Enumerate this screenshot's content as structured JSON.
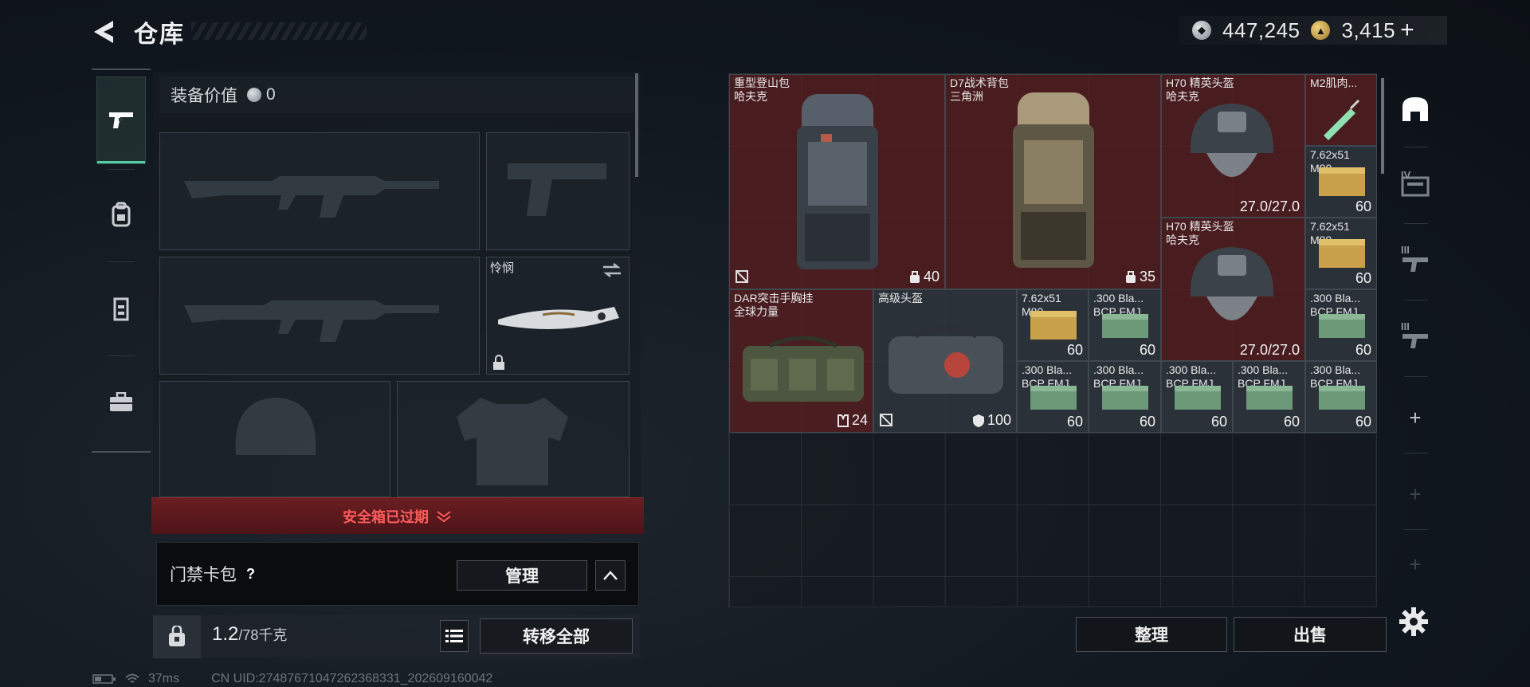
{
  "header": {
    "title": "仓库",
    "currency": [
      {
        "icon": "silver-coin-icon",
        "value": "447,245"
      },
      {
        "icon": "gold-coin-icon",
        "value": "3,415"
      }
    ],
    "add_symbol": "+"
  },
  "nav": [
    {
      "icon": "pistol-icon",
      "active": true
    },
    {
      "icon": "backpack-icon",
      "active": false
    },
    {
      "icon": "chest-rig-icon",
      "active": false
    },
    {
      "icon": "briefcase-icon",
      "active": false
    }
  ],
  "equipment": {
    "value_label": "装备价值",
    "value": "0",
    "melee_label": "怜悯",
    "safe_box_text": "安全箱已过期",
    "keycard_label": "门禁卡包",
    "help_symbol": "?",
    "manage_label": "管理",
    "weight_current": "1.2",
    "weight_max": "/78千克",
    "transfer_label": "转移全部"
  },
  "storage": {
    "items": [
      {
        "name": "重型登山包\n哈夫克",
        "badge": "40",
        "badge_icon": "capacity-icon",
        "corner_icon": "no-insure-icon",
        "bg": "red"
      },
      {
        "name": "D7战术背包\n三角洲",
        "badge": "35",
        "badge_icon": "capacity-icon",
        "corner_icon": "",
        "bg": "red"
      },
      {
        "name": "H70 精英头盔\n哈夫克",
        "count": "27.0/27.0",
        "bg": "red"
      },
      {
        "name": "M2肌肉...",
        "count": "",
        "bg": "red"
      },
      {
        "name": "7.62x51\nM80",
        "count": "60",
        "bg": "dark"
      },
      {
        "name": "H70 精英头盔\n哈夫克",
        "count": "27.0/27.0",
        "bg": "red"
      },
      {
        "name": "7.62x51\nM80",
        "count": "60",
        "bg": "dark"
      },
      {
        "name": "DAR突击手胸挂\n全球力量",
        "badge": "24",
        "badge_icon": "rig-capacity-icon",
        "bg": "red"
      },
      {
        "name": "高级头盔",
        "badge": "100",
        "badge_icon": "shield-icon",
        "corner_icon": "no-insure-icon",
        "bg": "dark"
      },
      {
        "name": "7.62x51\nM80",
        "count": "60",
        "bg": "dark"
      },
      {
        "name": ".300 Bla...\nBCP FMJ",
        "count": "60",
        "bg": "dark"
      },
      {
        "name": ".300 Bla...\nBCP FMJ",
        "count": "60",
        "bg": "dark"
      },
      {
        "name": ".300 Bla...\nBCP FMJ",
        "count": "60",
        "bg": "dark"
      },
      {
        "name": ".300 Bla...\nBCP FMJ",
        "count": "60",
        "bg": "dark"
      },
      {
        "name": ".300 Bla...\nBCP FMJ",
        "count": "60",
        "bg": "dark"
      },
      {
        "name": ".300 Bla...\nBCP FMJ",
        "count": "60",
        "bg": "dark"
      },
      {
        "name": ".300 Bla...\nBCP FMJ",
        "count": "60",
        "bg": "dark"
      }
    ],
    "sort_label": "整理",
    "sell_label": "出售"
  },
  "side_tools": {
    "tab_iv": "IV",
    "tab_iii_a": "III",
    "tab_iii_b": "III",
    "add": "+"
  },
  "status": {
    "ping": "37ms",
    "uid": "CN UID:27487671047262368331_202609160042"
  }
}
